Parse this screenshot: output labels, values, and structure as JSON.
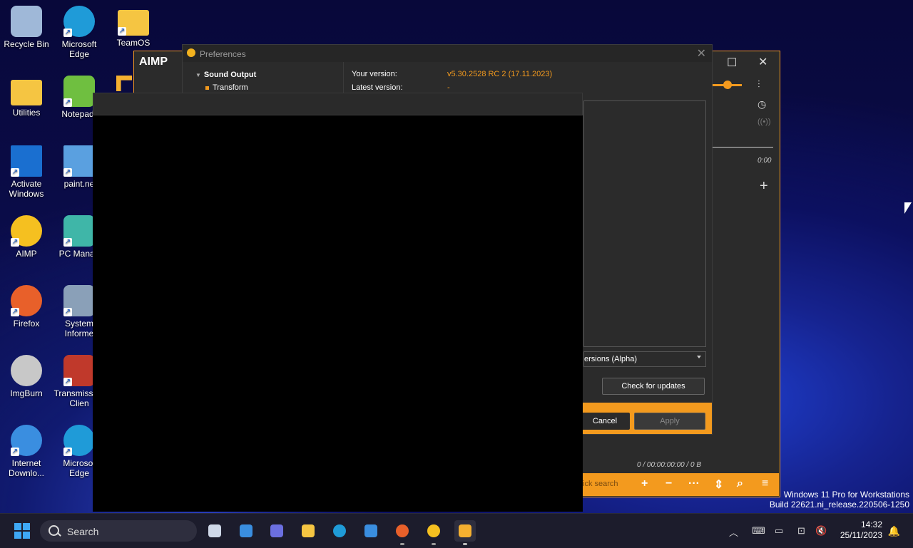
{
  "desktop": {
    "icons": [
      {
        "label": "Recycle Bin",
        "icon": "recycle-bin-icon",
        "color": "#9fb8d8"
      },
      {
        "label": "Microsoft Edge",
        "icon": "edge-icon",
        "color": "#1f9bd8"
      },
      {
        "label": "TeamOS",
        "icon": "folder-icon",
        "color": "#f5c542"
      },
      {
        "label": "Utilities",
        "icon": "folder-icon",
        "color": "#f5c542"
      },
      {
        "label": "Notepad-",
        "icon": "notepad-icon",
        "color": "#6fbf40"
      },
      {
        "label": "Activate Windows",
        "icon": "activate-windows-icon",
        "color": "#1a6fd0"
      },
      {
        "label": "paint.ne",
        "icon": "paint-net-icon",
        "color": "#5aa0e0"
      },
      {
        "label": "AIMP",
        "icon": "aimp-icon",
        "color": "#f5c020"
      },
      {
        "label": "PC Manag",
        "icon": "pc-manager-icon",
        "color": "#3fb6a8"
      },
      {
        "label": "Firefox",
        "icon": "firefox-icon",
        "color": "#e8602a"
      },
      {
        "label": "System Informe",
        "icon": "system-informer-icon",
        "color": "#8aa0b8"
      },
      {
        "label": "ImgBurn",
        "icon": "imgburn-icon",
        "color": "#c8c8c8"
      },
      {
        "label": "Transmiss Qt Clien",
        "icon": "transmission-icon",
        "color": "#c0392b"
      },
      {
        "label": "Internet Downlo...",
        "icon": "internet-download-manager-icon",
        "color": "#3a8ee0"
      },
      {
        "label": "Microsof Edge",
        "icon": "edge-icon",
        "color": "#1f9bd8"
      }
    ]
  },
  "aimp": {
    "logo": "AIMP",
    "time": "0:00",
    "status": "0 / 00:00:00:00 / 0 B",
    "quick_search": "ick search",
    "accent": "#f39a1e"
  },
  "preferences": {
    "title": "Preferences",
    "tree_section": "Sound Output",
    "tree_item": "Transform",
    "your_version_label": "Your version:",
    "your_version_value": "v5.30.2528 RC 2 (17.11.2023)",
    "latest_version_label": "Latest version:",
    "latest_version_value": "-",
    "channel_select": "ersions (Alpha)",
    "check_updates": "Check for updates",
    "cancel": "Cancel",
    "apply": "Apply"
  },
  "watermark": {
    "line1": "Windows 11 Pro for Workstations",
    "line2": "Build 22621.ni_release.220506-1250"
  },
  "taskbar": {
    "search_label": "Search",
    "time": "14:32",
    "date": "25/11/2023",
    "apps": [
      {
        "icon": "task-view-icon",
        "color": "#cfd8e8"
      },
      {
        "icon": "widgets-icon",
        "color": "#3a8ee0"
      },
      {
        "icon": "teams-chat-icon",
        "color": "#6b6fe0"
      },
      {
        "icon": "file-explorer-icon",
        "color": "#f5c542"
      },
      {
        "icon": "edge-icon",
        "color": "#1f9bd8"
      },
      {
        "icon": "microsoft-store-icon",
        "color": "#3a8ee0"
      },
      {
        "icon": "firefox-icon",
        "color": "#e8602a"
      },
      {
        "icon": "aimp-icon",
        "color": "#f5c020"
      },
      {
        "icon": "capture-app-icon",
        "color": "#f5b030"
      }
    ]
  }
}
